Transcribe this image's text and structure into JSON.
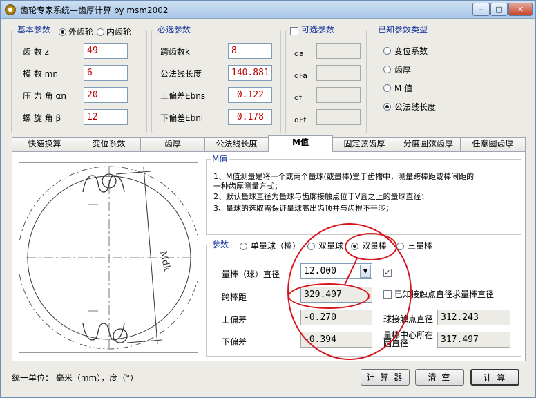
{
  "window": {
    "title": "齿轮专家系统—齿厚计算 by msm2002",
    "minimize": "–",
    "maximize": "□",
    "close": "✕"
  },
  "basic": {
    "title": "基本参数",
    "external": "外齿轮",
    "internal": "内齿轮",
    "external_selected": true,
    "rows": [
      {
        "label": "齿    数 z",
        "value": "49"
      },
      {
        "label": "模    数 mn",
        "value": "6"
      },
      {
        "label": "压 力 角 αn",
        "value": "20"
      },
      {
        "label": "螺 旋 角 β",
        "value": "12"
      }
    ]
  },
  "required": {
    "title": "必选参数",
    "rows": [
      {
        "label": "跨齿数k",
        "value": "8"
      },
      {
        "label": "公法线长度",
        "value": "140.881"
      },
      {
        "label": "上偏差Ebns",
        "value": "-0.122"
      },
      {
        "label": "下偏差Ebni",
        "value": "-0.178"
      }
    ]
  },
  "optional": {
    "title": "可选参数",
    "checked": false,
    "rows": [
      {
        "label": "da"
      },
      {
        "label": "dFa"
      },
      {
        "label": "df"
      },
      {
        "label": "dFf"
      }
    ]
  },
  "known": {
    "title": "已知参数类型",
    "options": [
      "变位系数",
      "齿厚",
      "M 值",
      "公法线长度"
    ],
    "selected": "公法线长度"
  },
  "tabs": {
    "items": [
      "快速换算",
      "变位系数",
      "齿厚",
      "公法线长度",
      "M值",
      "固定弦齿厚",
      "分度圆弦齿厚",
      "任意圆齿厚"
    ],
    "active": "M值"
  },
  "mvalue": {
    "info_title": "M值",
    "info": [
      "1、M值测量是将一个或两个量球(或量棒)置于齿槽中，测量跨棒距或棒间距的",
      "    一种齿厚测量方式；",
      "2、默认量球直径为量球与齿廓接触点位于V圆之上的量球直径；",
      "3、量球的选取需保证量球高出齿顶并与齿根不干涉；"
    ],
    "diagram_label": "Mdk",
    "params_title": "参数",
    "modes": [
      "单量球（棒）",
      "双量球",
      "双量棒",
      "三量棒"
    ],
    "mode_selected": "双量棒",
    "ball_dia_label": "量棒（球）直径",
    "ball_dia_value": "12.000",
    "ball_dia_checked": true,
    "span_label": "跨棒距",
    "span_value": "329.497",
    "upper_label": "上偏差",
    "upper_value": "-0.270",
    "lower_label": "下偏差",
    "lower_value": "-0.394",
    "contact_check_label": "已知接触点直径求量棒直径",
    "contact_checked": false,
    "contact_dia_label": "球接触点直径",
    "contact_dia_value": "312.243",
    "center_dia_label": "量棒中心所在圆直径",
    "center_dia_value": "317.497"
  },
  "footer": {
    "units": "统一单位：  毫米（mm），度（°）",
    "calculator": "计 算 器",
    "clear": "清  空",
    "compute": "计  算"
  },
  "colors": {
    "group_title": "#1c3a9c",
    "input_value": "#c00000",
    "annotation": "#d8141c"
  }
}
